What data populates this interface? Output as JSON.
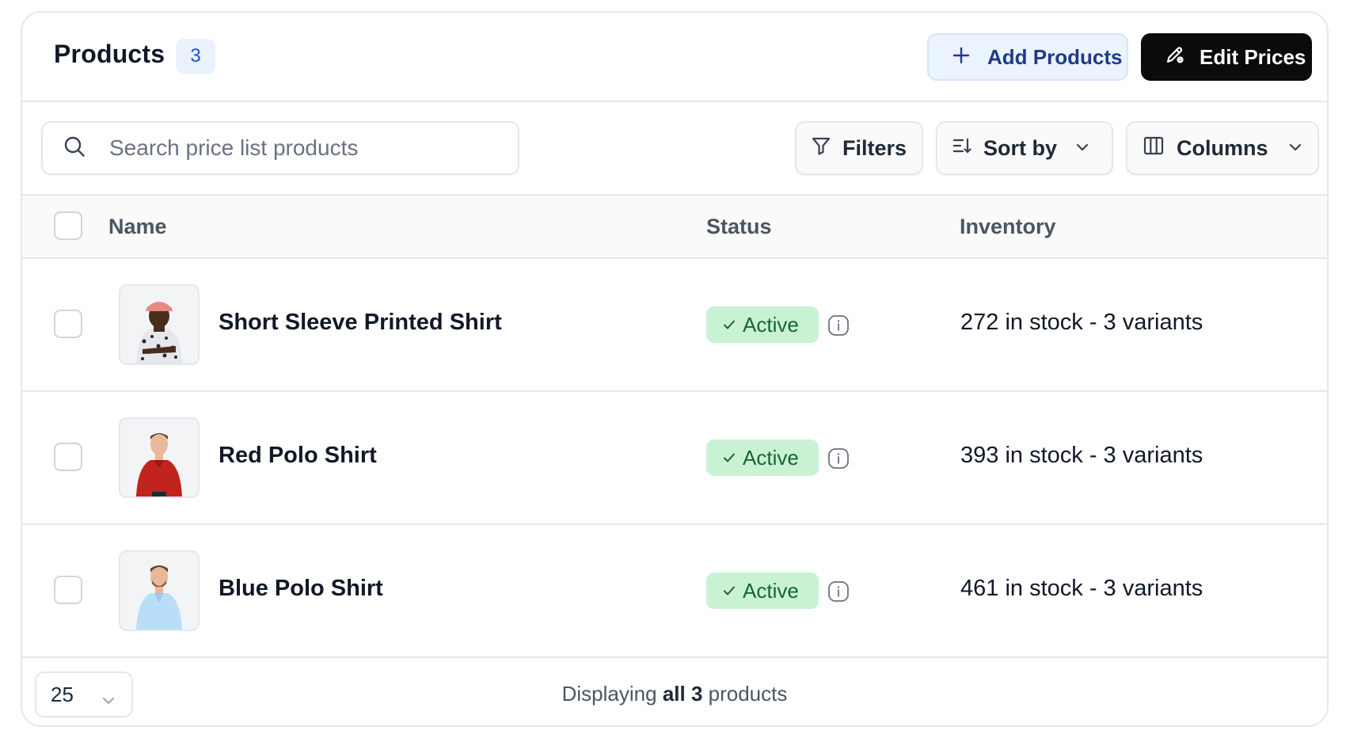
{
  "header": {
    "title": "Products",
    "count": "3",
    "add_button": "Add Products",
    "edit_button": "Edit Prices"
  },
  "toolbar": {
    "search_placeholder": "Search price list products",
    "filters_label": "Filters",
    "sort_label": "Sort by",
    "columns_label": "Columns"
  },
  "table": {
    "columns": [
      "Name",
      "Status",
      "Inventory"
    ],
    "rows": [
      {
        "name": "Short Sleeve Printed Shirt",
        "status": "Active",
        "inventory": "272 in stock - 3 variants",
        "shirt_color": "#e5e7eb"
      },
      {
        "name": "Red Polo Shirt",
        "status": "Active",
        "inventory": "393 in stock - 3 variants",
        "shirt_color": "#c0241c"
      },
      {
        "name": "Blue Polo Shirt",
        "status": "Active",
        "inventory": "461 in stock - 3 variants",
        "shirt_color": "#b9defa"
      }
    ]
  },
  "footer": {
    "page_size": "25",
    "display_prefix": "Displaying",
    "display_bold": "all 3",
    "display_suffix": "products"
  },
  "colors": {
    "status_bg": "#c9f2d4",
    "status_text": "#166534",
    "primary_dark": "#0b0b0b",
    "accent_blue": "#1e3a8a"
  }
}
